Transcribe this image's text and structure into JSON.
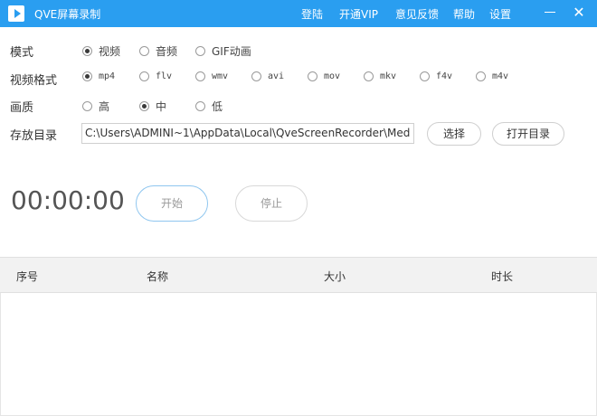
{
  "app": {
    "title": "QVE屏幕录制"
  },
  "menu": {
    "login": "登陆",
    "vip": "开通VIP",
    "feedback": "意见反馈",
    "help": "帮助",
    "settings": "设置"
  },
  "mode": {
    "label": "模式",
    "options": [
      "视频",
      "音频",
      "GIF动画"
    ],
    "selected": "视频"
  },
  "format": {
    "label": "视频格式",
    "options": [
      "mp4",
      "flv",
      "wmv",
      "avi",
      "mov",
      "mkv",
      "f4v",
      "m4v"
    ],
    "selected": "mp4"
  },
  "quality": {
    "label": "画质",
    "options": [
      "高",
      "中",
      "低"
    ],
    "selected": "中"
  },
  "save": {
    "label": "存放目录",
    "path": "C:\\Users\\ADMINI~1\\AppData\\Local\\QveScreenRecorder\\Med",
    "choose_label": "选择",
    "open_label": "打开目录"
  },
  "recorder": {
    "timer": "00:00:00",
    "start_label": "开始",
    "stop_label": "停止"
  },
  "table": {
    "columns": [
      "序号",
      "名称",
      "大小",
      "时长"
    ],
    "rows": []
  },
  "colors": {
    "accent": "#2a9ef0"
  }
}
